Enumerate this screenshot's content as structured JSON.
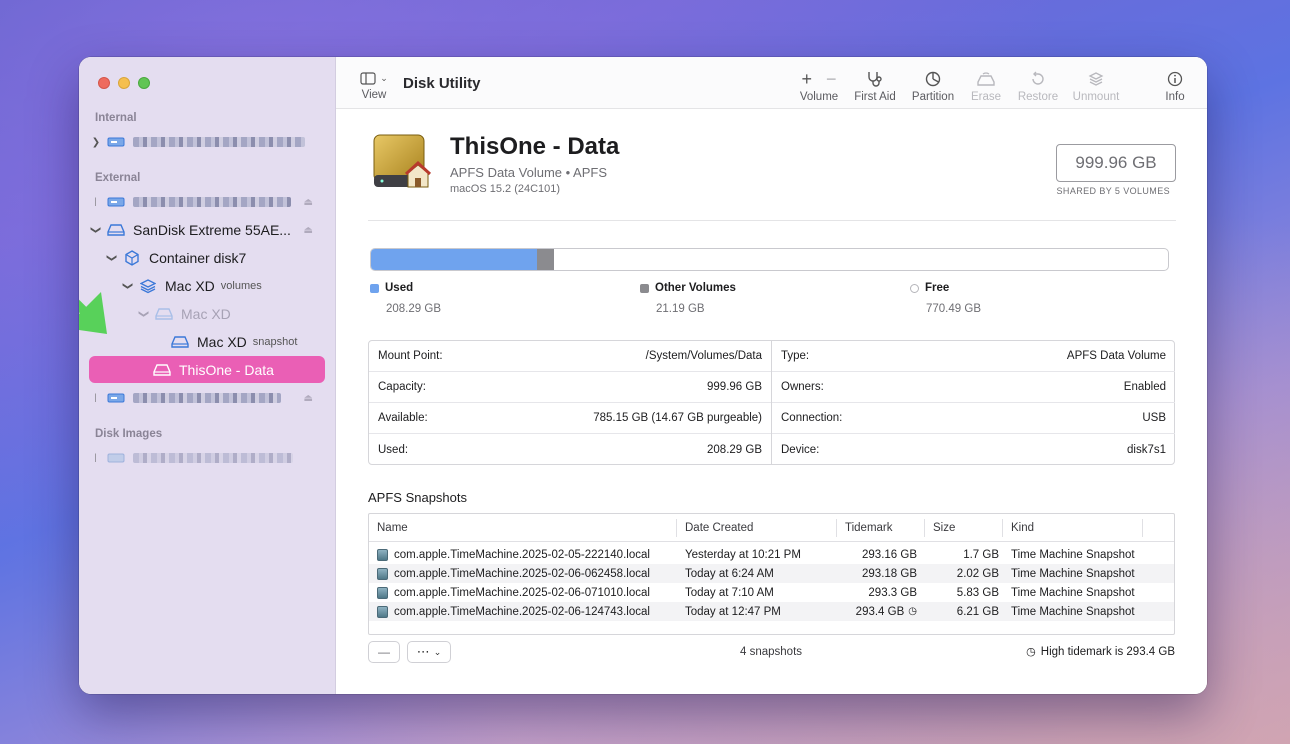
{
  "app": {
    "title": "Disk Utility"
  },
  "toolbar": {
    "view_label": "View",
    "volume_label": "Volume",
    "first_aid_label": "First Aid",
    "partition_label": "Partition",
    "erase_label": "Erase",
    "restore_label": "Restore",
    "unmount_label": "Unmount",
    "info_label": "Info"
  },
  "sidebar": {
    "section_internal": "Internal",
    "section_external": "External",
    "section_disk_images": "Disk Images",
    "items": [
      {
        "label": "SanDisk Extreme 55AE...",
        "small": ""
      },
      {
        "label": "Container disk7",
        "small": ""
      },
      {
        "label": "Mac XD",
        "small": "volumes"
      },
      {
        "label": "Mac XD",
        "small": ""
      },
      {
        "label": "Mac XD",
        "small": "snapshot"
      },
      {
        "label": "ThisOne - Data",
        "small": ""
      }
    ]
  },
  "volume": {
    "name": "ThisOne - Data",
    "subtitle": "APFS Data Volume • APFS",
    "os": "macOS 15.2 (24C101)",
    "capacity": "999.96 GB",
    "shared": "SHARED BY 5 VOLUMES"
  },
  "usage": {
    "used_fraction": 0.2083,
    "other_fraction": 0.0212,
    "used_label": "Used",
    "used_value": "208.29 GB",
    "other_label": "Other Volumes",
    "other_value": "21.19 GB",
    "free_label": "Free",
    "free_value": "770.49 GB",
    "colors": {
      "used": "#6fa3ee",
      "other": "#8b8b8f",
      "free": "#ffffff"
    }
  },
  "info": {
    "left": [
      {
        "key": "Mount Point:",
        "value": "/System/Volumes/Data"
      },
      {
        "key": "Capacity:",
        "value": "999.96 GB"
      },
      {
        "key": "Available:",
        "value": "785.15 GB (14.67 GB purgeable)"
      },
      {
        "key": "Used:",
        "value": "208.29 GB"
      }
    ],
    "right": [
      {
        "key": "Type:",
        "value": "APFS Data Volume"
      },
      {
        "key": "Owners:",
        "value": "Enabled"
      },
      {
        "key": "Connection:",
        "value": "USB"
      },
      {
        "key": "Device:",
        "value": "disk7s1"
      }
    ]
  },
  "snapshots": {
    "title": "APFS Snapshots",
    "columns": [
      "Name",
      "Date Created",
      "Tidemark",
      "Size",
      "Kind"
    ],
    "rows": [
      {
        "name": "com.apple.TimeMachine.2025-02-05-222140.local",
        "date": "Yesterday at 10:21 PM",
        "tidemark": "293.16 GB",
        "size": "1.7 GB",
        "kind": "Time Machine Snapshot"
      },
      {
        "name": "com.apple.TimeMachine.2025-02-06-062458.local",
        "date": "Today at 6:24 AM",
        "tidemark": "293.18 GB",
        "size": "2.02 GB",
        "kind": "Time Machine Snapshot"
      },
      {
        "name": "com.apple.TimeMachine.2025-02-06-071010.local",
        "date": "Today at 7:10 AM",
        "tidemark": "293.3 GB",
        "size": "5.83 GB",
        "kind": "Time Machine Snapshot"
      },
      {
        "name": "com.apple.TimeMachine.2025-02-06-124743.local",
        "date": "Today at 12:47 PM",
        "tidemark": "293.4 GB",
        "size": "6.21 GB",
        "kind": "Time Machine Snapshot"
      }
    ],
    "count": "4 snapshots",
    "high_tidemark": "High tidemark is 293.4 GB",
    "remove_label": "—"
  },
  "accent": "#ea5fb5"
}
